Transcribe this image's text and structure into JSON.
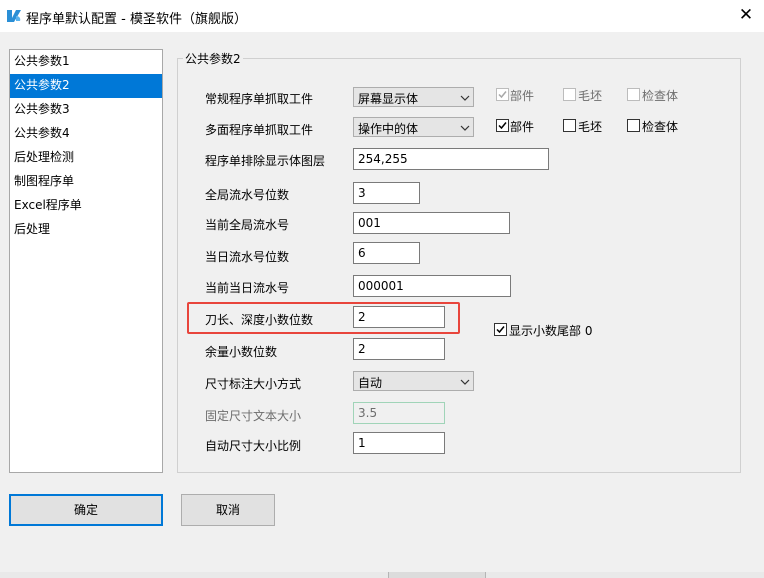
{
  "window": {
    "title": "程序单默认配置 - 模圣软件（旗舰版）",
    "close_glyph": "✕"
  },
  "sidebar": {
    "items": [
      {
        "label": "公共参数1",
        "selected": false
      },
      {
        "label": "公共参数2",
        "selected": true
      },
      {
        "label": "公共参数3",
        "selected": false
      },
      {
        "label": "公共参数4",
        "selected": false
      },
      {
        "label": "后处理检测",
        "selected": false
      },
      {
        "label": "制图程序单",
        "selected": false
      },
      {
        "label": "Excel程序单",
        "selected": false
      },
      {
        "label": "后处理",
        "selected": false
      }
    ]
  },
  "group": {
    "title": "公共参数2"
  },
  "fields": {
    "regular_grab_label": "常规程序单抓取工件",
    "regular_grab_value": "屏幕显示体",
    "multi_grab_label": "多面程序单抓取工件",
    "multi_grab_value": "操作中的体",
    "exclude_layers_label": "程序单排除显示体图层",
    "exclude_layers_value": "254,255",
    "global_serial_digits_label": "全局流水号位数",
    "global_serial_digits_value": "3",
    "current_global_serial_label": "当前全局流水号",
    "current_global_serial_value": "001",
    "daily_serial_digits_label": "当日流水号位数",
    "daily_serial_digits_value": "6",
    "current_daily_serial_label": "当前当日流水号",
    "current_daily_serial_value": "000001",
    "tool_decimal_label": "刀长、深度小数位数",
    "tool_decimal_value": "2",
    "allowance_decimal_label": "余量小数位数",
    "allowance_decimal_value": "2",
    "dimension_mode_label": "尺寸标注大小方式",
    "dimension_mode_value": "自动",
    "fixed_text_size_label": "固定尺寸文本大小",
    "fixed_text_size_value": "3.5",
    "auto_scale_label": "自动尺寸大小比例",
    "auto_scale_value": "1"
  },
  "checkboxes": {
    "row1": [
      {
        "label": "部件",
        "checked": true,
        "enabled": false
      },
      {
        "label": "毛坯",
        "checked": false,
        "enabled": false
      },
      {
        "label": "检查体",
        "checked": false,
        "enabled": false
      }
    ],
    "row2": [
      {
        "label": "部件",
        "checked": true,
        "enabled": true
      },
      {
        "label": "毛坯",
        "checked": false,
        "enabled": true
      },
      {
        "label": "检查体",
        "checked": false,
        "enabled": true
      }
    ],
    "show_trailing_zero": {
      "label": "显示小数尾部 0",
      "checked": true,
      "enabled": true
    }
  },
  "buttons": {
    "ok": "确定",
    "cancel": "取消"
  },
  "colors": {
    "selection": "#0078d7",
    "highlight_box": "#e8453c",
    "app_icon": "#2a8fd6"
  }
}
